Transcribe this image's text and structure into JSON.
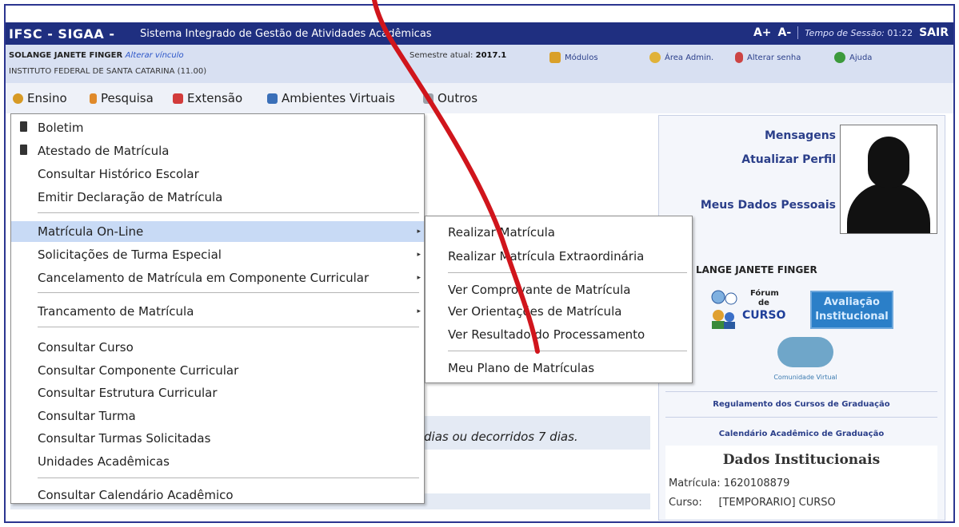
{
  "header": {
    "brand": "IFSC - SIGAA -",
    "subtitle": "Sistema Integrado de Gestão de Atividades Acadêmicas",
    "font_increase": "A+",
    "font_decrease": "A-",
    "session_label": "Tempo de Sessão:",
    "session_time": "01:22",
    "logout": "SAIR"
  },
  "user_bar": {
    "user_name": "SOLANGE JANETE FINGER",
    "change_link": "Alterar vínculo",
    "institution": "INSTITUTO FEDERAL DE SANTA CATARINA (11.00)",
    "semester_label": "Semestre atual:",
    "semester_value": "2017.1",
    "modules": "Módulos",
    "admin": "Área Admin.",
    "password": "Alterar senha",
    "help": "Ajuda"
  },
  "menu": {
    "tabs": [
      "Ensino",
      "Pesquisa",
      "Extensão",
      "Ambientes Virtuais",
      "Outros"
    ]
  },
  "dropdown": {
    "items": [
      "Boletim",
      "Atestado de Matrícula",
      "Consultar Histórico Escolar",
      "Emitir Declaração de Matrícula",
      "Matrícula On-Line",
      "Solicitações de Turma Especial",
      "Cancelamento de Matrícula em Componente Curricular",
      "Trancamento de Matrícula",
      "Consultar Curso",
      "Consultar Componente Curricular",
      "Consultar Estrutura Curricular",
      "Consultar Turma",
      "Consultar Turmas Solicitadas",
      "Unidades Acadêmicas",
      "Consultar Calendário Acadêmico"
    ]
  },
  "submenu": {
    "items": [
      "Realizar Matrícula",
      "Realizar Matrícula Extraordinária",
      "Ver Comprovante de Matrícula",
      "Ver Orientações de Matrícula",
      "Ver Resultado do Processamento",
      "Meu Plano de Matrículas"
    ]
  },
  "profile": {
    "messages": "Mensagens",
    "update_profile": "Atualizar Perfil",
    "personal_data": "Meus Dados Pessoais",
    "name": "LANGE JANETE FINGER",
    "forum_line1": "Fórum",
    "forum_line2": "de",
    "forum_line3": "CURSO",
    "evaluation_line1": "Avaliação",
    "evaluation_line2": "Institucional",
    "community": "Comunidade Virtual",
    "regulation_link": "Regulamento dos Cursos de Graduação",
    "calendar_link": "Calendário Acadêmico de Graduação",
    "institutional_title": "Dados Institucionais",
    "enrollment_label": "Matrícula:",
    "enrollment_value": "1620108879",
    "course_label": "Curso:",
    "course_value": "[TEMPORARIO] CURSO"
  },
  "main": {
    "notice_text": "dias ou decorridos 7 dias."
  },
  "colors": {
    "header_bg": "#1f2f80",
    "info_bg": "#d8e0f2",
    "active_item": "#c8daf5",
    "annotation_red": "#d0151c"
  }
}
